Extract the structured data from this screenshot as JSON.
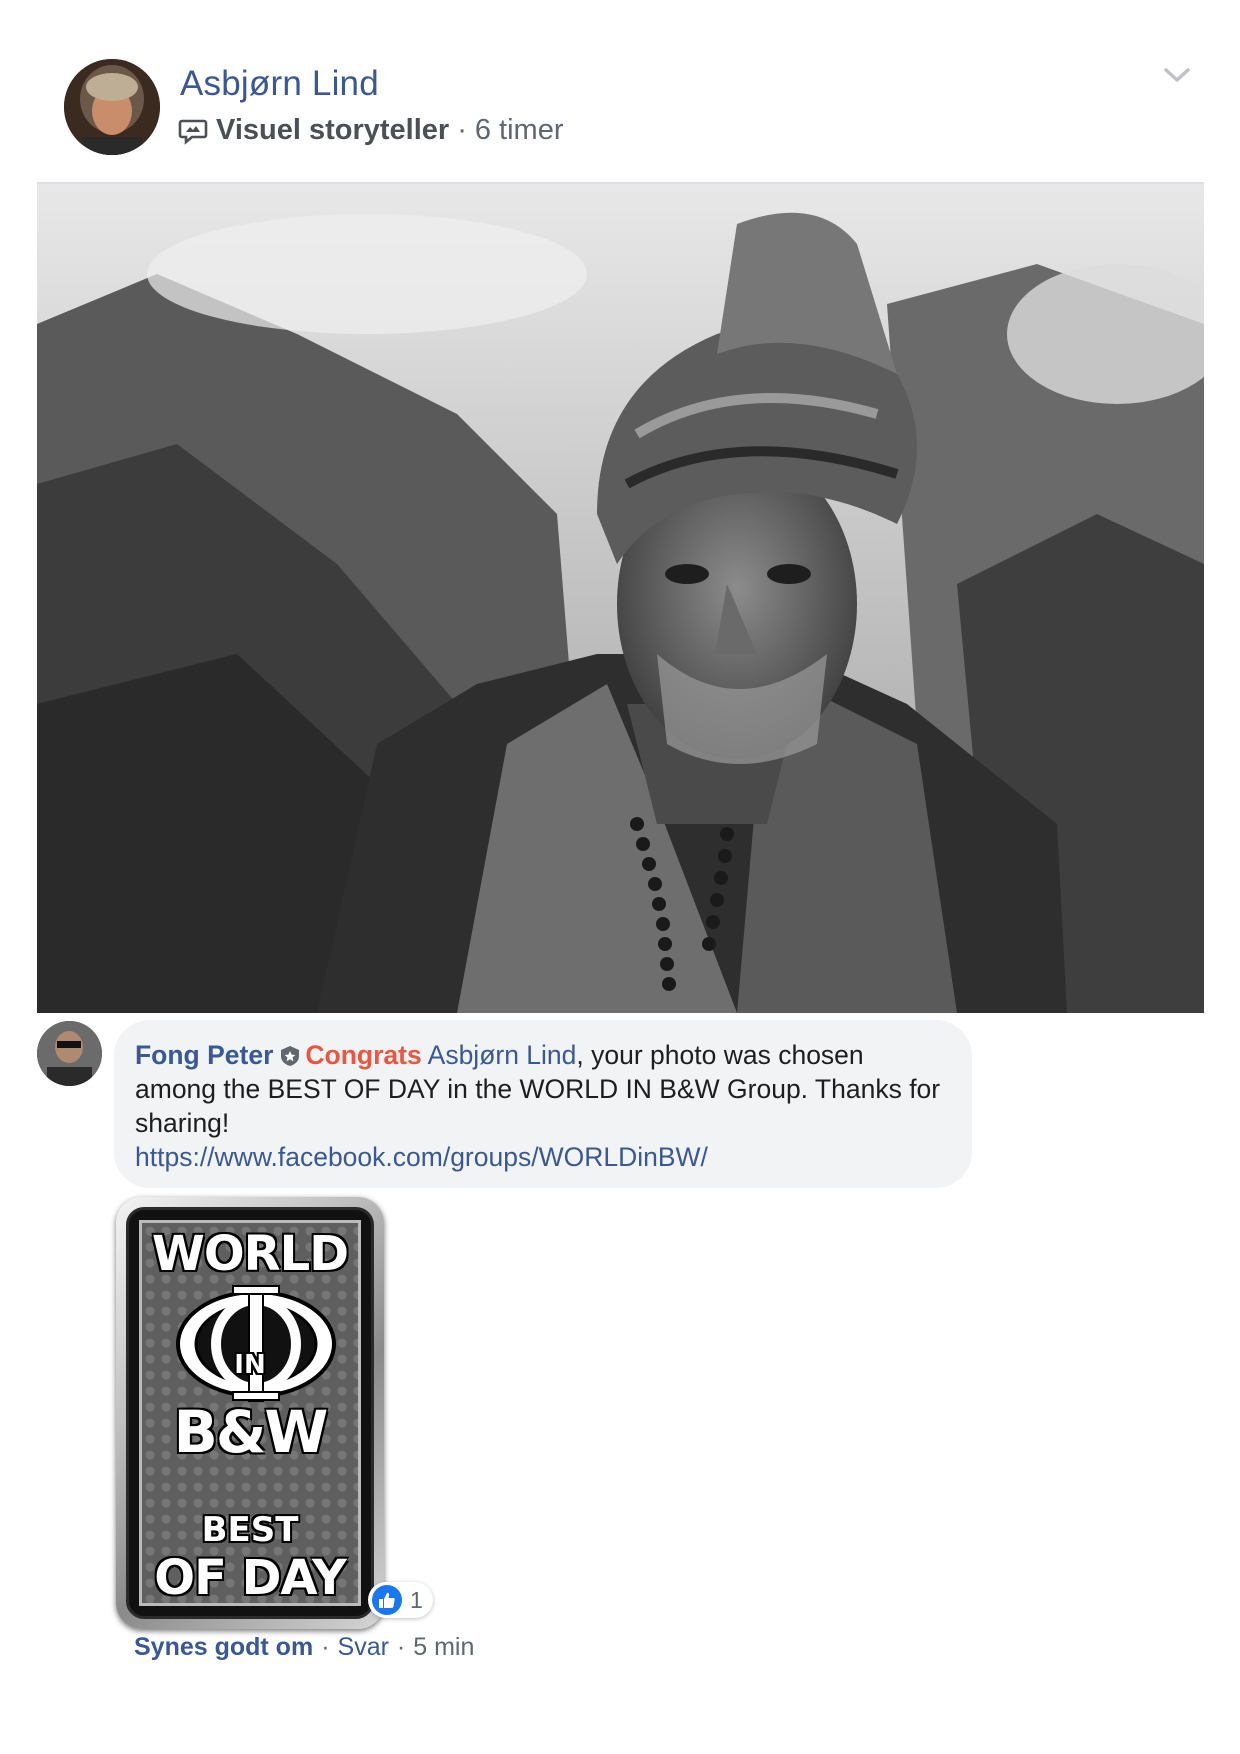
{
  "post": {
    "author": "Asbjørn Lind",
    "role": "Visuel storyteller",
    "separator": "·",
    "time": "6 timer",
    "icons": {
      "author_avatar": "avatar",
      "role_badge": "speech-bubble-icon",
      "menu": "chevron-down-icon"
    }
  },
  "comment": {
    "author": "Fong Peter",
    "badge_icon": "shield-star-icon",
    "highlight": "Congrats",
    "mention": "Asbjørn Lind",
    "text_after_mention": ", your photo was chosen among the BEST OF DAY in the WORLD IN B&W Group. Thanks for sharing!",
    "link": "https://www.facebook.com/groups/WORLDinBW/",
    "sticker": {
      "line1": "WORLD",
      "line2": "IN",
      "line3": "B&W",
      "line4": "BEST",
      "line5": "OF DAY"
    },
    "reaction": {
      "icon": "thumbs-up-icon",
      "count": "1"
    },
    "actions": {
      "like": "Synes godt om",
      "separator": "·",
      "reply": "Svar",
      "time": "5 min"
    }
  },
  "colors": {
    "link_blue": "#385898",
    "congrats_red": "#e9573f",
    "bubble_bg": "#f2f3f5",
    "like_blue": "#1877f2"
  }
}
